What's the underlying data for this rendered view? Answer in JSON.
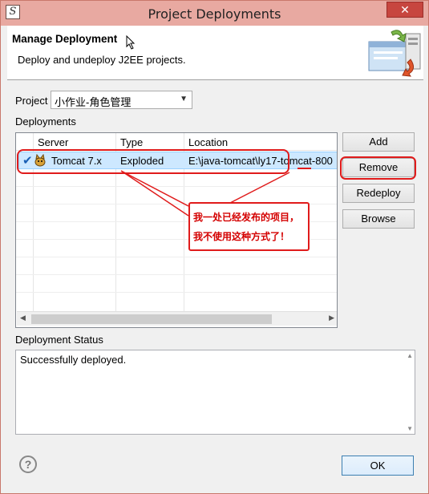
{
  "window": {
    "title": "Project Deployments",
    "app_icon_glyph": "S",
    "close_glyph": "✕"
  },
  "header": {
    "title": "Manage Deployment",
    "description": "Deploy and undeploy J2EE projects."
  },
  "project": {
    "label": "Project",
    "selected": "小作业-角色管理"
  },
  "deployments": {
    "label": "Deployments",
    "columns": [
      "Server",
      "Type",
      "Location"
    ],
    "rows": [
      {
        "server": "Tomcat  7.x",
        "type": "Exploded",
        "location": "E:\\java-tomcat\\ly17-tomcat-800",
        "selected": true
      }
    ]
  },
  "buttons": {
    "add": "Add",
    "remove": "Remove",
    "redeploy": "Redeploy",
    "browse": "Browse",
    "ok": "OK"
  },
  "status": {
    "label": "Deployment Status",
    "text": "Successfully deployed."
  },
  "annotation": {
    "line1": "我一处已经发布的项目，",
    "line2": "我不使用这种方式了！",
    "color": "#e01b1b"
  },
  "colors": {
    "titlebar": "#e8a9a1",
    "selection": "#cde8ff",
    "close": "#c7463f"
  }
}
